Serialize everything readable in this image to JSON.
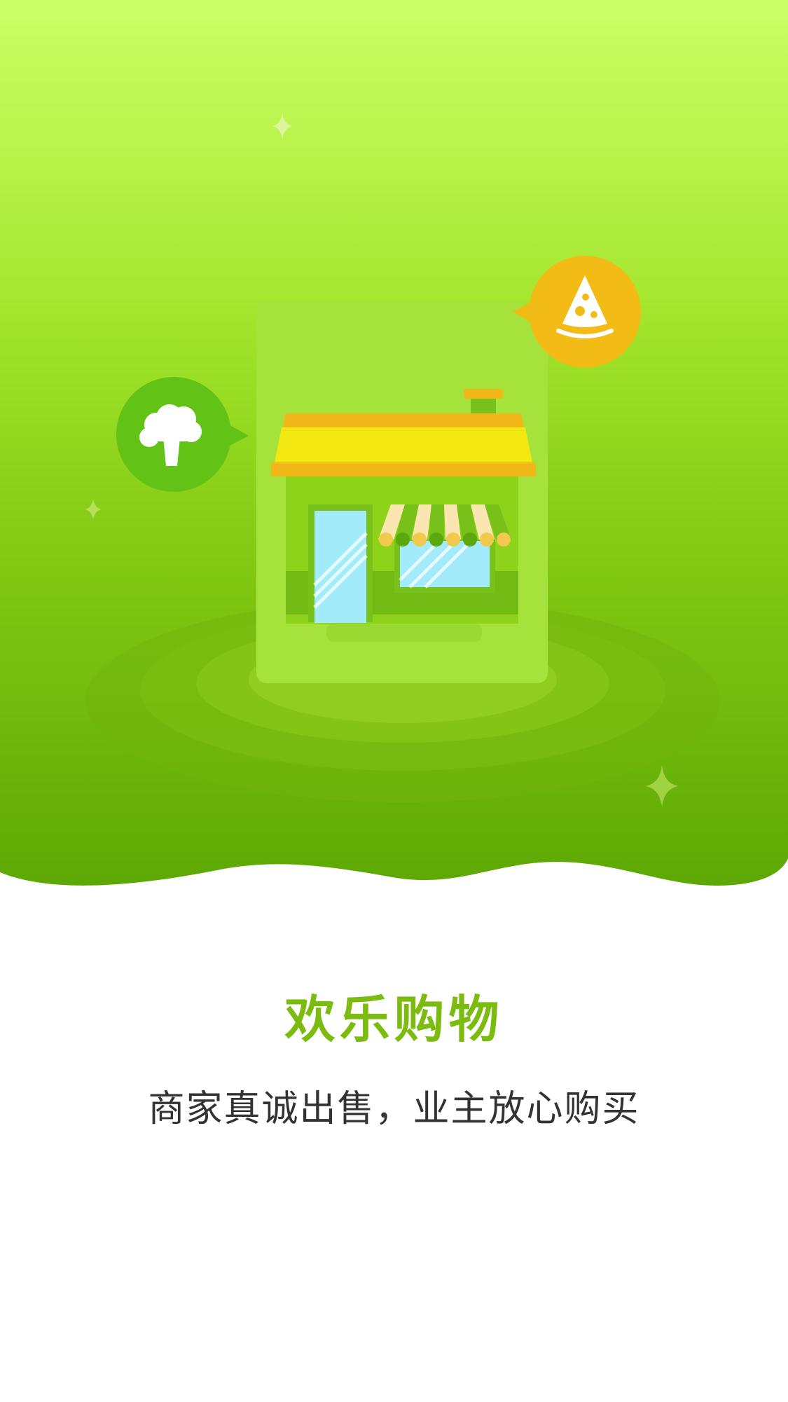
{
  "onboarding": {
    "title": "欢乐购物",
    "subtitle": "商家真诚出售，业主放心购买"
  },
  "illustration": {
    "subject": "shop-storefront",
    "badges": [
      "broccoli-icon",
      "pizza-slice-icon"
    ],
    "colors": {
      "bg_top": "#ccff66",
      "bg_mid": "#95d91c",
      "bg_bottom": "#5ea805",
      "title": "#7cbc10",
      "roof": "#f4e812",
      "roof_edge": "#f2b81a",
      "glass": "#a2ebfb",
      "orange_badge": "#f2bb16",
      "green_badge": "#62c316"
    }
  }
}
